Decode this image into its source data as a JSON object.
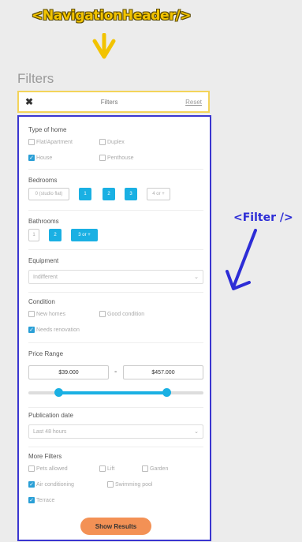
{
  "annotations": {
    "nav": "<NavigationHeader/>",
    "filter": "<Filter />"
  },
  "page": {
    "section_title": "Filters"
  },
  "nav_header": {
    "close_symbol": "✖",
    "title": "Filters",
    "reset": "Reset"
  },
  "type_of_home": {
    "title": "Type of home",
    "options": [
      {
        "label": "Flat/Apartment",
        "checked": false
      },
      {
        "label": "Duplex",
        "checked": false
      },
      {
        "label": "House",
        "checked": true
      },
      {
        "label": "Penthouse",
        "checked": false
      }
    ]
  },
  "bedrooms": {
    "title": "Bedrooms",
    "options": [
      "0 (studio flat)",
      "1",
      "2",
      "3",
      "4 or +"
    ],
    "selected": [
      1,
      2,
      3
    ]
  },
  "bathrooms": {
    "title": "Bathrooms",
    "options": [
      "1",
      "2",
      "3 or +"
    ],
    "selected": [
      1,
      2
    ]
  },
  "equipment": {
    "title": "Equipment",
    "value": "Indifferent"
  },
  "condition": {
    "title": "Condition",
    "options": [
      {
        "label": "New homes",
        "checked": false
      },
      {
        "label": "Good condition",
        "checked": false
      },
      {
        "label": "Needs renovation",
        "checked": true
      }
    ]
  },
  "price_range": {
    "title": "Price Range",
    "min": "$39.000",
    "max": "$457.000",
    "separator": "-",
    "min_fraction": 0.17,
    "max_fraction": 0.79
  },
  "publication_date": {
    "title": "Publication date",
    "value": "Last 48 hours"
  },
  "more_filters": {
    "title": "More Filters",
    "options": [
      {
        "label": "Pets allowed",
        "checked": false
      },
      {
        "label": "Lift",
        "checked": false
      },
      {
        "label": "Garden",
        "checked": false
      },
      {
        "label": "Air conditioning",
        "checked": true
      },
      {
        "label": "Swimming pool",
        "checked": false
      },
      {
        "label": "Terrace",
        "checked": true
      }
    ]
  },
  "actions": {
    "show_results": "Show Results"
  },
  "colors": {
    "accent": "#1ab0e3",
    "button": "#f39155",
    "nav_outline": "#f3d45a",
    "filter_outline": "#3a36d0"
  }
}
